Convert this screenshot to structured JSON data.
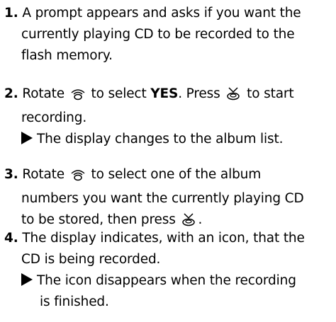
{
  "steps": [
    {
      "number": "1.",
      "line1": "A prompt appears and asks if you want the",
      "line2": "currently playing CD to be recorded to the",
      "line3": "flash memory."
    },
    {
      "number": "2.",
      "text_a": "Rotate",
      "text_b": "to select",
      "bold": "YES",
      "text_c": ". Press",
      "text_d": "to start",
      "line2": "recording.",
      "note": "The display changes to the album list."
    },
    {
      "number": "3.",
      "text_a": "Rotate",
      "text_b": "to select one of the album",
      "line2": "numbers you want the currently playing CD",
      "line3": "to be stored, then press",
      "line3_end": "."
    },
    {
      "number": "4.",
      "line1": "The display indicates, with an icon, that the",
      "line2": "CD is being recorded.",
      "note_line1": "The icon disappears when the recording",
      "note_line2": "is finished."
    }
  ],
  "icons": {
    "rotary": "rotary-knob-icon",
    "press": "press-button-icon"
  }
}
